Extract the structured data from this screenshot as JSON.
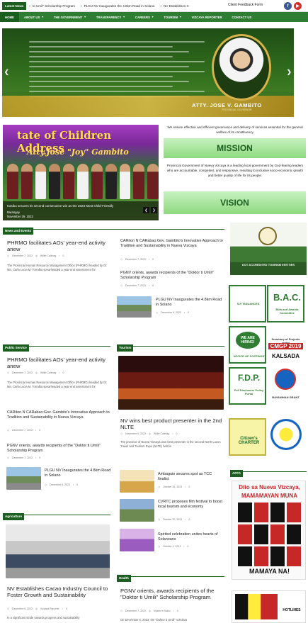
{
  "topbar": {
    "ticker_label": "Latest News",
    "ticker": [
      "to Umil\" Scholarship Program",
      "PLGU NV Inaugurates the 4.8km Road in Solano",
      "NV Establishes C"
    ],
    "feedback": "Client Feedback Form",
    "fb_icon": "facebook-icon",
    "yt_icon": "youtube-icon"
  },
  "nav": {
    "items": [
      "HOME",
      "ABOUT US",
      "THE GOVERNMENT",
      "TRANSPARENCY",
      "CAREERS",
      "TOURISM",
      "VIZCAYA REPORTER",
      "CONTACT US"
    ]
  },
  "hero": {
    "name": "ATTY. JOSE V. GAMBITO",
    "subtitle": "PROVINCIAL GOVERNOR"
  },
  "slide2": {
    "title_line1": "tate of Children Address",
    "title_line2": "Atty.Jose \"Joy\" Gambito",
    "caption": "Kasibu secures its second consecutive win as the 2023 Most Child-Friendly",
    "caption2": "Barangay",
    "caption3": "November 29, 2023"
  },
  "mission": {
    "statement": "We ensure effective and efficient governance and delivery of services essential for the general welfare of its constituency.",
    "label": "MISSION"
  },
  "vision": {
    "statement": "Provincial Government of Nueva Vizcaya is a leading local government by God-fearing leaders who are accountable, competent, and responsive, resulting to inclusive socio-economic growth and better quality of life for its people.",
    "label": "VISION"
  },
  "sections": {
    "news": "News and Events",
    "public": "Public Service",
    "tourism": "Tourism",
    "agriculture": "Agriculture",
    "health": "Health",
    "arta": "ARTA"
  },
  "news": {
    "main": {
      "title": "PHRMO facilitates AOs' year-end activity anew",
      "date": "December 7, 2023",
      "author": "Willet Calimag",
      "comments": "0",
      "excerpt": "The Provincial Human Resource Management Office (PHRMO) headed by Dr. Ma. Carla Lucia M. Torralba spearheaded a year-end assessment for"
    },
    "side": [
      {
        "title": "CARiton N CARabao:Gov. Gambito's Innovative Approach to Tradition and Sustainability in Nueva Vizcaya",
        "date": "December 7, 2023",
        "comments": "0"
      },
      {
        "title": "PGNV orients, awards recipients of the \"Doktor ti Umili\" Scholarship Program",
        "date": "December 7, 2023",
        "comments": "0"
      },
      {
        "title": "PLGU NV Inaugurates the 4.8km Road in Solano",
        "date": "December 6, 2023",
        "comments": "0"
      }
    ]
  },
  "public": {
    "main": {
      "title": "PHRMO facilitates AOs' year-end activity anew",
      "date": "December 7, 2023",
      "author": "Willet Calimag",
      "comments": "0",
      "excerpt": "The Provincial Human Resource Management Office (PHRMO) headed by Dr. Ma. Carla Lucia M. Torralba spearheaded a year-end assessment for"
    },
    "list": [
      {
        "title": "CARiton N CARabao:Gov. Gambito's Innovative Approach to Tradition and Sustainability in Nueva Vizcaya",
        "date": "December 7, 2023",
        "comments": "0"
      },
      {
        "title": "PGNV orients, awards recipients of the \"Doktor ti Umili\" Scholarship Program",
        "date": "December 7, 2023",
        "comments": "0"
      },
      {
        "title": "PLGU NV Inaugurates the 4.8km Road in Solano",
        "date": "December 6, 2023",
        "comments": "0"
      }
    ]
  },
  "tourism": {
    "main": {
      "title": "NV wins best product presenter in the 2nd NLTE",
      "date": "November 5, 2023",
      "author": "Willet Calimag",
      "comments": "0",
      "excerpt": "The province of Nueva Vizcaya won best presenter in the second North Luzon Travel and Tourism Expo (NLTE) held in"
    },
    "list": [
      {
        "title": "Ambaguio secures spot as TCC finalist",
        "date": "October 26, 2023",
        "comments": "0"
      },
      {
        "title": "CVRTC proposes film festival to boost local tourism and economy",
        "date": "October 20, 2023",
        "comments": "0"
      },
      {
        "title": "Spirited celebration unites hearts of Solanoans",
        "date": "October 4, 2023",
        "comments": "0"
      }
    ]
  },
  "agriculture": {
    "main": {
      "title": "NV Establishes Cacao Industry Council to Foster Growth and Sustainability",
      "date": "December 5, 2023",
      "author": "Vizcaya Reporter",
      "comments": "0",
      "excerpt": "In a significant stride towards progress and sustainability"
    }
  },
  "health": {
    "main": {
      "title": "PGNV orients, awards recipients of the \"Doktor ti Umili\" Scholarship Program",
      "date": "December 7, 2023",
      "author": "Mylene's Sabio",
      "comments": "0",
      "excerpt": "On December 5, 2023, the \"Doktor ti Umili\" scholars"
    }
  },
  "ads": {
    "dot": "DOT ACCREDITED TOURISM ENTITIES",
    "bac": "B.A.C.",
    "bac_sub": "Bids and Awards Committee",
    "we_are_hiring": "WE ARE HIRING!",
    "notice": "NOTICE OF POSTINGS",
    "cmgp": "CMGP 2019",
    "cmgp_sub": "Summary of Projects under",
    "kalsada": "KALSADA",
    "fdp": "F.D.P.",
    "fdp_sub": "Full Disclosure Policy Portal",
    "bayanihan": "BAYANIHAN GRANT",
    "citizens": "Citizen's CHARTER",
    "sp": "S.P. ISSUANCES",
    "arta_title": "Dito sa Nueva Vizcaya,",
    "arta_title2": "MAMAMAYAN MUNA",
    "arta_bottom": "MAMAYA NA!",
    "hotlines": "HOTLINES"
  }
}
